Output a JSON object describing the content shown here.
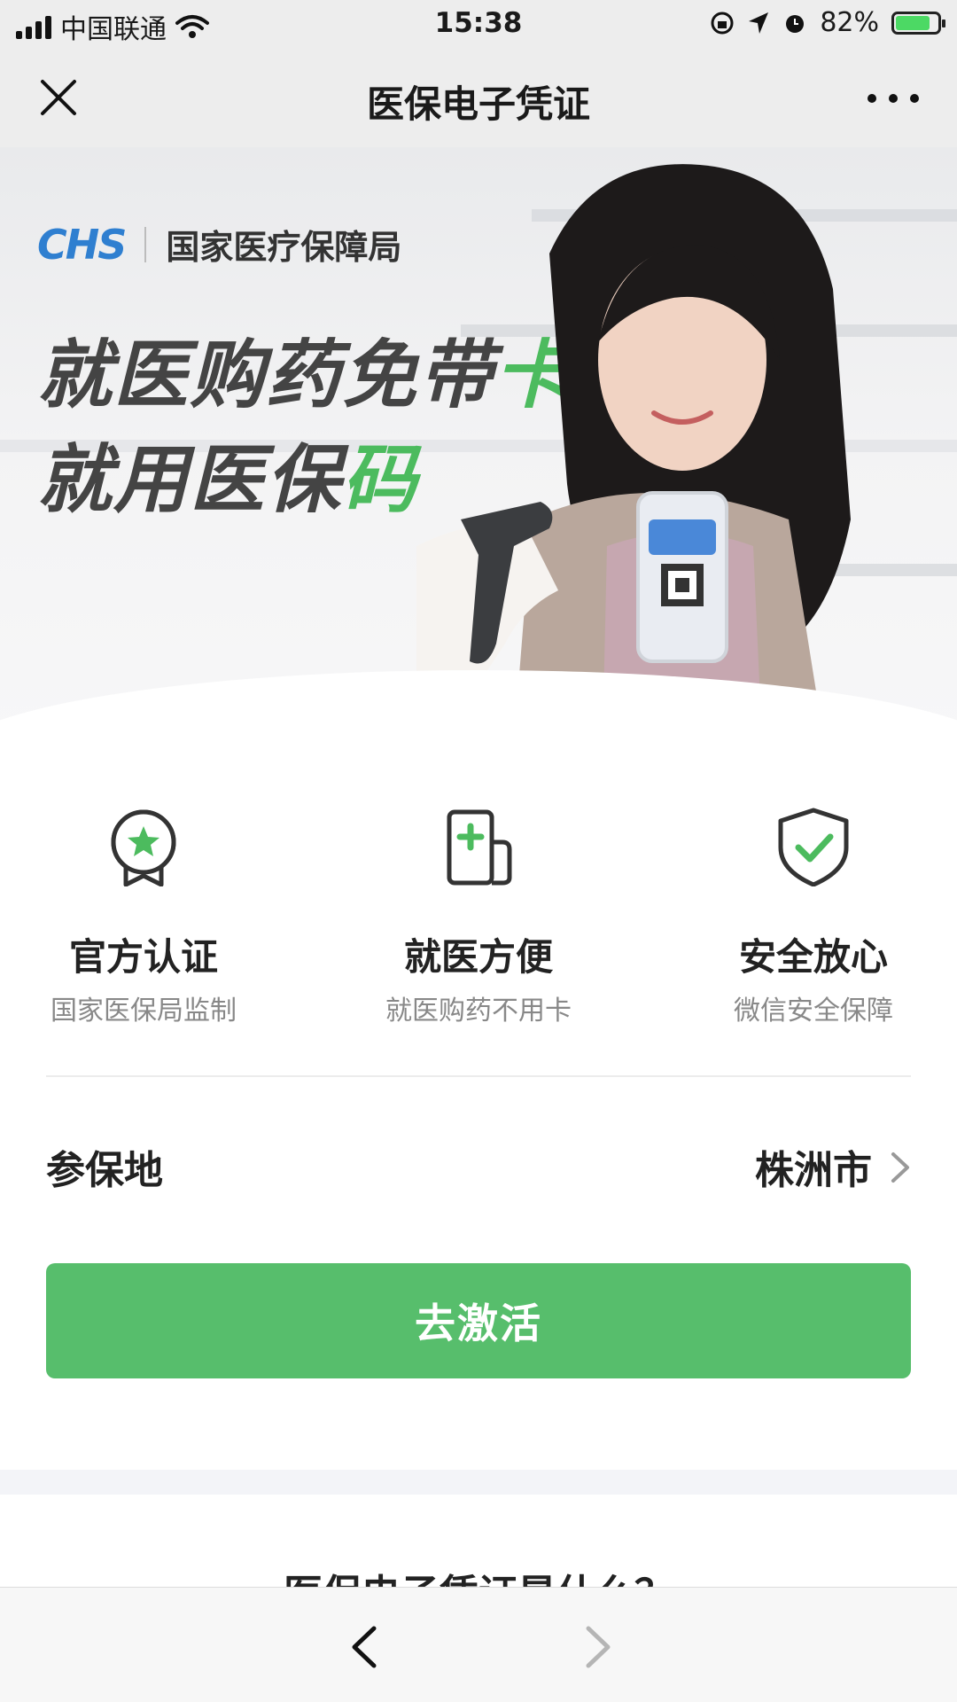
{
  "status_bar": {
    "carrier": "中国联通",
    "time": "15:38",
    "battery": "82%"
  },
  "nav": {
    "title": "医保电子凭证"
  },
  "banner": {
    "logo_text": "CHS",
    "org_name": "国家医疗保障局",
    "slogan_line1_main": "就医购药免带",
    "slogan_line1_highlight": "卡",
    "slogan_line2_main": "就用医保",
    "slogan_line2_highlight": "码",
    "accent_color": "#4cbb5e"
  },
  "features": [
    {
      "icon": "award-badge-icon",
      "title": "官方认证",
      "subtitle": "国家医保局监制"
    },
    {
      "icon": "medical-card-icon",
      "title": "就医方便",
      "subtitle": "就医购药不用卡"
    },
    {
      "icon": "shield-check-icon",
      "title": "安全放心",
      "subtitle": "微信安全保障"
    }
  ],
  "location": {
    "label": "参保地",
    "value": "株洲市"
  },
  "primary_button": {
    "label": "去激活",
    "color": "#57be6c"
  },
  "section": {
    "title": "医保电子凭证是什么？"
  }
}
